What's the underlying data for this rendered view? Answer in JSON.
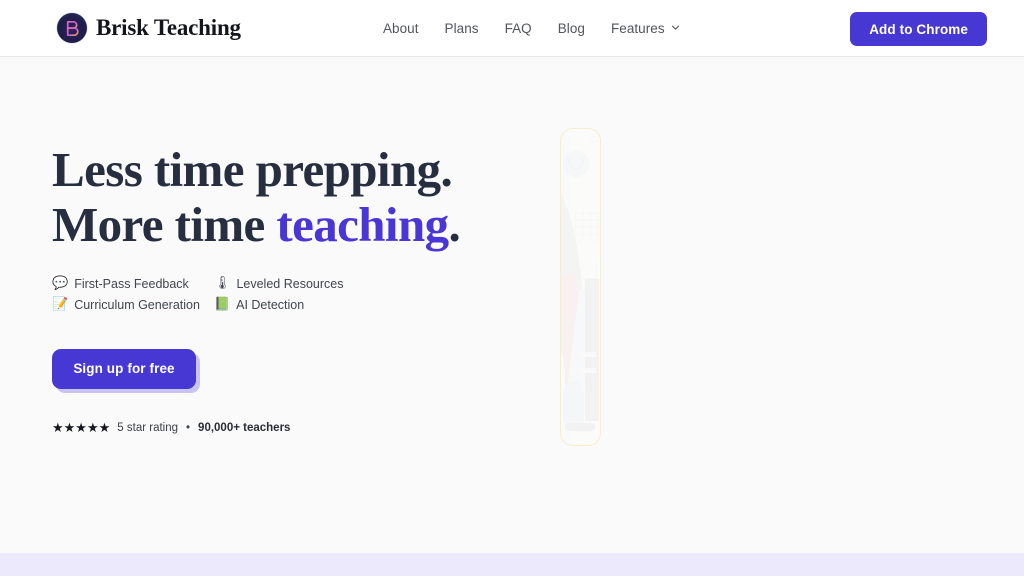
{
  "header": {
    "brand": {
      "name": "Brisk Teaching",
      "logo_icon": "brisk-b-monogram-icon",
      "logo_bg_color": "#221f50"
    },
    "nav": [
      {
        "label": "About",
        "icon": null
      },
      {
        "label": "Plans",
        "icon": null
      },
      {
        "label": "FAQ",
        "icon": null
      },
      {
        "label": "Blog",
        "icon": null
      },
      {
        "label": "Features",
        "icon": "chevron-down-icon"
      }
    ],
    "cta": {
      "label": "Add to Chrome",
      "bg_color": "#4737d3",
      "text_color": "#ffffff"
    }
  },
  "hero": {
    "headline": {
      "line1": "Less time prepping.",
      "line2_plain": "More time ",
      "line2_accent": "teaching",
      "line2_period": ".",
      "color": "#262e3f",
      "accent_color": "#4a35d6"
    },
    "features": [
      {
        "emoji": "💬",
        "icon_name": "speech-balloon-icon",
        "label": "First-Pass Feedback"
      },
      {
        "emoji": "🌡",
        "icon_name": "thermometer-icon",
        "label": "Leveled Resources"
      },
      {
        "emoji": "📝",
        "icon_name": "memo-icon",
        "label": "Curriculum Generation"
      },
      {
        "emoji": "📗",
        "icon_name": "green-book-icon",
        "label": "AI Detection"
      }
    ],
    "signup": {
      "label": "Sign up for free",
      "bg_color": "#4737d3",
      "shadow_color": "#c9c4ef"
    },
    "rating": {
      "stars": "★★★★★",
      "star_count": 5,
      "text": "5 star rating",
      "separator": "•",
      "bold_text": "90,000+ teachers"
    },
    "artwork": {
      "alt": "classroom illustration card",
      "border_color": "#f6eec8"
    }
  },
  "lower_band": {
    "bg_color": "#ebe9fb"
  }
}
